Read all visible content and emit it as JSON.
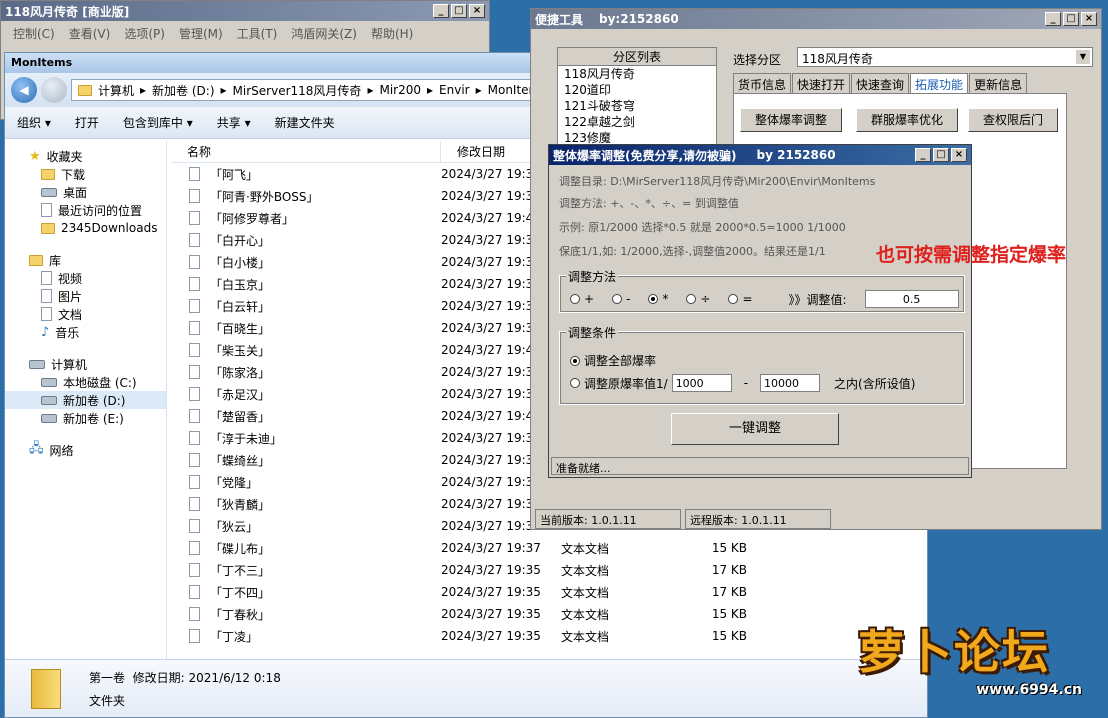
{
  "app_window": {
    "title": "118风月传奇 [商业版]",
    "menu": [
      "控制(C)",
      "查看(V)",
      "选项(P)",
      "管理(M)",
      "工具(T)",
      "鸿盾网关(Z)",
      "帮助(H)"
    ]
  },
  "explorer": {
    "title": "MonItems",
    "address": [
      "计算机",
      "新加卷 (D:)",
      "MirServer118风月传奇",
      "Mir200",
      "Envir",
      "MonItems"
    ],
    "toolbar": [
      "组织",
      "打开",
      "包含到库中",
      "共享",
      "新建文件夹"
    ],
    "nav": {
      "favorites": "收藏夹",
      "favorites_items": [
        "下载",
        "桌面",
        "最近访问的位置",
        "2345Downloads"
      ],
      "libraries": "库",
      "library_items": [
        "视频",
        "图片",
        "文档",
        "音乐"
      ],
      "computer": "计算机",
      "computer_items": [
        "本地磁盘 (C:)",
        "新加卷 (D:)",
        "新加卷 (E:)"
      ],
      "network": "网络"
    },
    "columns": {
      "name": "名称",
      "date": "修改日期"
    },
    "files": [
      {
        "name": "「阿飞」",
        "date": "2024/3/27 19:3",
        "type": "",
        "size": ""
      },
      {
        "name": "「阿青·野外BOSS」",
        "date": "2024/3/27 19:3",
        "type": "",
        "size": ""
      },
      {
        "name": "「阿修罗尊者」",
        "date": "2024/3/27 19:4",
        "type": "",
        "size": ""
      },
      {
        "name": "「白开心」",
        "date": "2024/3/27 19:3",
        "type": "",
        "size": ""
      },
      {
        "name": "「白小楼」",
        "date": "2024/3/27 19:3",
        "type": "",
        "size": ""
      },
      {
        "name": "「白玉京」",
        "date": "2024/3/27 19:3",
        "type": "",
        "size": ""
      },
      {
        "name": "「白云轩」",
        "date": "2024/3/27 19:3",
        "type": "",
        "size": ""
      },
      {
        "name": "「百晓生」",
        "date": "2024/3/27 19:3",
        "type": "",
        "size": ""
      },
      {
        "name": "「柴玉关」",
        "date": "2024/3/27 19:4",
        "type": "",
        "size": ""
      },
      {
        "name": "「陈家洛」",
        "date": "2024/3/27 19:3",
        "type": "",
        "size": ""
      },
      {
        "name": "「赤足汉」",
        "date": "2024/3/27 19:3",
        "type": "",
        "size": ""
      },
      {
        "name": "「楚留香」",
        "date": "2024/3/27 19:4",
        "type": "",
        "size": ""
      },
      {
        "name": "「淳于未迪」",
        "date": "2024/3/27 19:3",
        "type": "",
        "size": ""
      },
      {
        "name": "「蝶绮丝」",
        "date": "2024/3/27 19:3",
        "type": "",
        "size": ""
      },
      {
        "name": "「党隆」",
        "date": "2024/3/27 19:3",
        "type": "",
        "size": ""
      },
      {
        "name": "「狄青麟」",
        "date": "2024/3/27 19:3",
        "type": "",
        "size": ""
      },
      {
        "name": "「狄云」",
        "date": "2024/3/27 19:3",
        "type": "",
        "size": ""
      },
      {
        "name": "「碟儿布」",
        "date": "2024/3/27 19:37",
        "type": "文本文档",
        "size": "15 KB"
      },
      {
        "name": "「丁不三」",
        "date": "2024/3/27 19:35",
        "type": "文本文档",
        "size": "17 KB"
      },
      {
        "name": "「丁不四」",
        "date": "2024/3/27 19:35",
        "type": "文本文档",
        "size": "17 KB"
      },
      {
        "name": "「丁春秋」",
        "date": "2024/3/27 19:35",
        "type": "文本文档",
        "size": "15 KB"
      },
      {
        "name": "「丁凌」",
        "date": "2024/3/27 19:35",
        "type": "文本文档",
        "size": "15 KB"
      }
    ],
    "status": {
      "name": "第一卷",
      "date_label": "修改日期:",
      "date": "2021/6/12 0:18",
      "type": "文件夹"
    }
  },
  "tool_window": {
    "title": "便捷工具",
    "author": "by:2152860",
    "list_header": "分区列表",
    "partitions": [
      "118风月传奇",
      "120道印",
      "121斗破苍穹",
      "122卓越之剑",
      "123修魔"
    ],
    "select_label": "选择分区",
    "select_value": "118风月传奇",
    "tabs": [
      "货币信息",
      "快速打开",
      "快速查询",
      "拓展功能",
      "更新信息"
    ],
    "active_tab": 3,
    "buttons": [
      "整体爆率调整",
      "群服爆率优化",
      "查权限后门"
    ],
    "current_version": "当前版本: 1.0.1.11",
    "remote_version": "远程版本: 1.0.1.11"
  },
  "dialog": {
    "title": "整体爆率调整(免费分享,请勿被骗)",
    "author": "by 2152860",
    "dir_line": "调整目录: D:\\MirServer118风月传奇\\Mir200\\Envir\\MonItems",
    "method_line": "调整方法: +、-、*、÷、=   到调整值",
    "example_line": "示例: 原1/2000 选择*0.5 就是 2000*0.5=1000  1/1000",
    "note_line": "保底1/1,如: 1/2000,选择-,调整值2000。结果还是1/1",
    "method_group": "调整方法",
    "ops": [
      "+",
      "-",
      "*",
      "÷",
      "="
    ],
    "selected_op": 2,
    "value_label": "》》调整值:",
    "value": "0.5",
    "cond_group": "调整条件",
    "cond_all": "调整全部爆率",
    "cond_range": "调整原爆率值1/",
    "range_from": "1000",
    "range_dash": "-",
    "range_to": "10000",
    "range_suffix": "之内(含所设值)",
    "run_button": "一键调整",
    "status": "准备就绪..."
  },
  "annotation": "也可按需调整指定爆率",
  "watermark": {
    "text": "萝卜论坛",
    "url": "www.6994.cn"
  }
}
